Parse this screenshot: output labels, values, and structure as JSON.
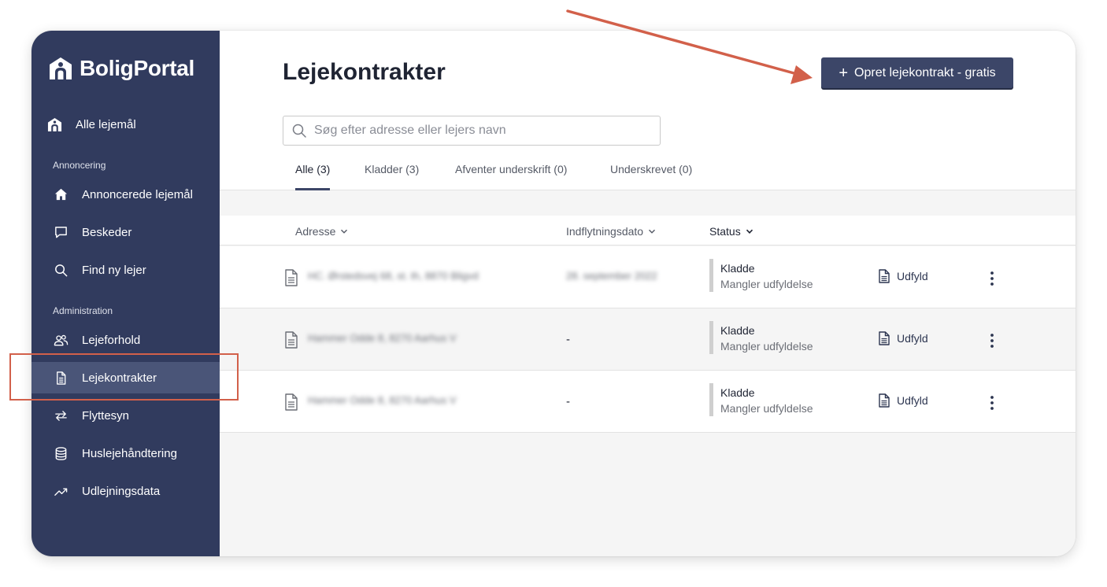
{
  "brand": {
    "name": "BoligPortal"
  },
  "sidebar": {
    "all_label": "Alle lejemål",
    "sections": [
      {
        "label": "Annoncering"
      },
      {
        "label": "Administration"
      }
    ],
    "items": [
      {
        "label": "Annoncerede lejemål",
        "icon": "house-icon"
      },
      {
        "label": "Beskeder",
        "icon": "chat-icon"
      },
      {
        "label": "Find ny lejer",
        "icon": "search-icon"
      },
      {
        "label": "Lejeforhold",
        "icon": "people-icon"
      },
      {
        "label": "Lejekontrakter",
        "icon": "document-icon",
        "active": true
      },
      {
        "label": "Flyttesyn",
        "icon": "swap-arrows-icon"
      },
      {
        "label": "Huslejehåndtering",
        "icon": "database-icon"
      },
      {
        "label": "Udlejningsdata",
        "icon": "trend-up-icon"
      }
    ]
  },
  "main": {
    "title": "Lejekontrakter",
    "create_button": {
      "icon": "+",
      "label": "Opret lejekontrakt - gratis"
    },
    "search": {
      "placeholder": "Søg efter adresse eller lejers navn"
    },
    "tabs": [
      {
        "label": "Alle (3)",
        "active": true
      },
      {
        "label": "Kladder (3)"
      },
      {
        "label": "Afventer underskrift (0)"
      },
      {
        "label": "Underskrevet (0)"
      }
    ],
    "table": {
      "columns": [
        "Adresse",
        "Indflytningsdato",
        "Status"
      ],
      "rows": [
        {
          "address": "HC. Ørstedsvej 68, st. th, 8870 Bligvd",
          "move_in": "28. september 2022",
          "status": "Kladde",
          "status_detail": "Mangler udfyldelse",
          "action": "Udfyld"
        },
        {
          "address": "Hammer Odde 8, 8270 Aarhus V",
          "move_in": "-",
          "status": "Kladde",
          "status_detail": "Mangler udfyldelse",
          "action": "Udfyld"
        },
        {
          "address": "Hammer Odde 8, 8270 Aarhus V",
          "move_in": "-",
          "status": "Kladde",
          "status_detail": "Mangler udfyldelse",
          "action": "Udfyld"
        }
      ]
    }
  },
  "colors": {
    "sidebar_bg": "#313b5e",
    "sidebar_active": "#4a5578",
    "button_bg": "#3c4668",
    "annotation": "#d2604a"
  }
}
